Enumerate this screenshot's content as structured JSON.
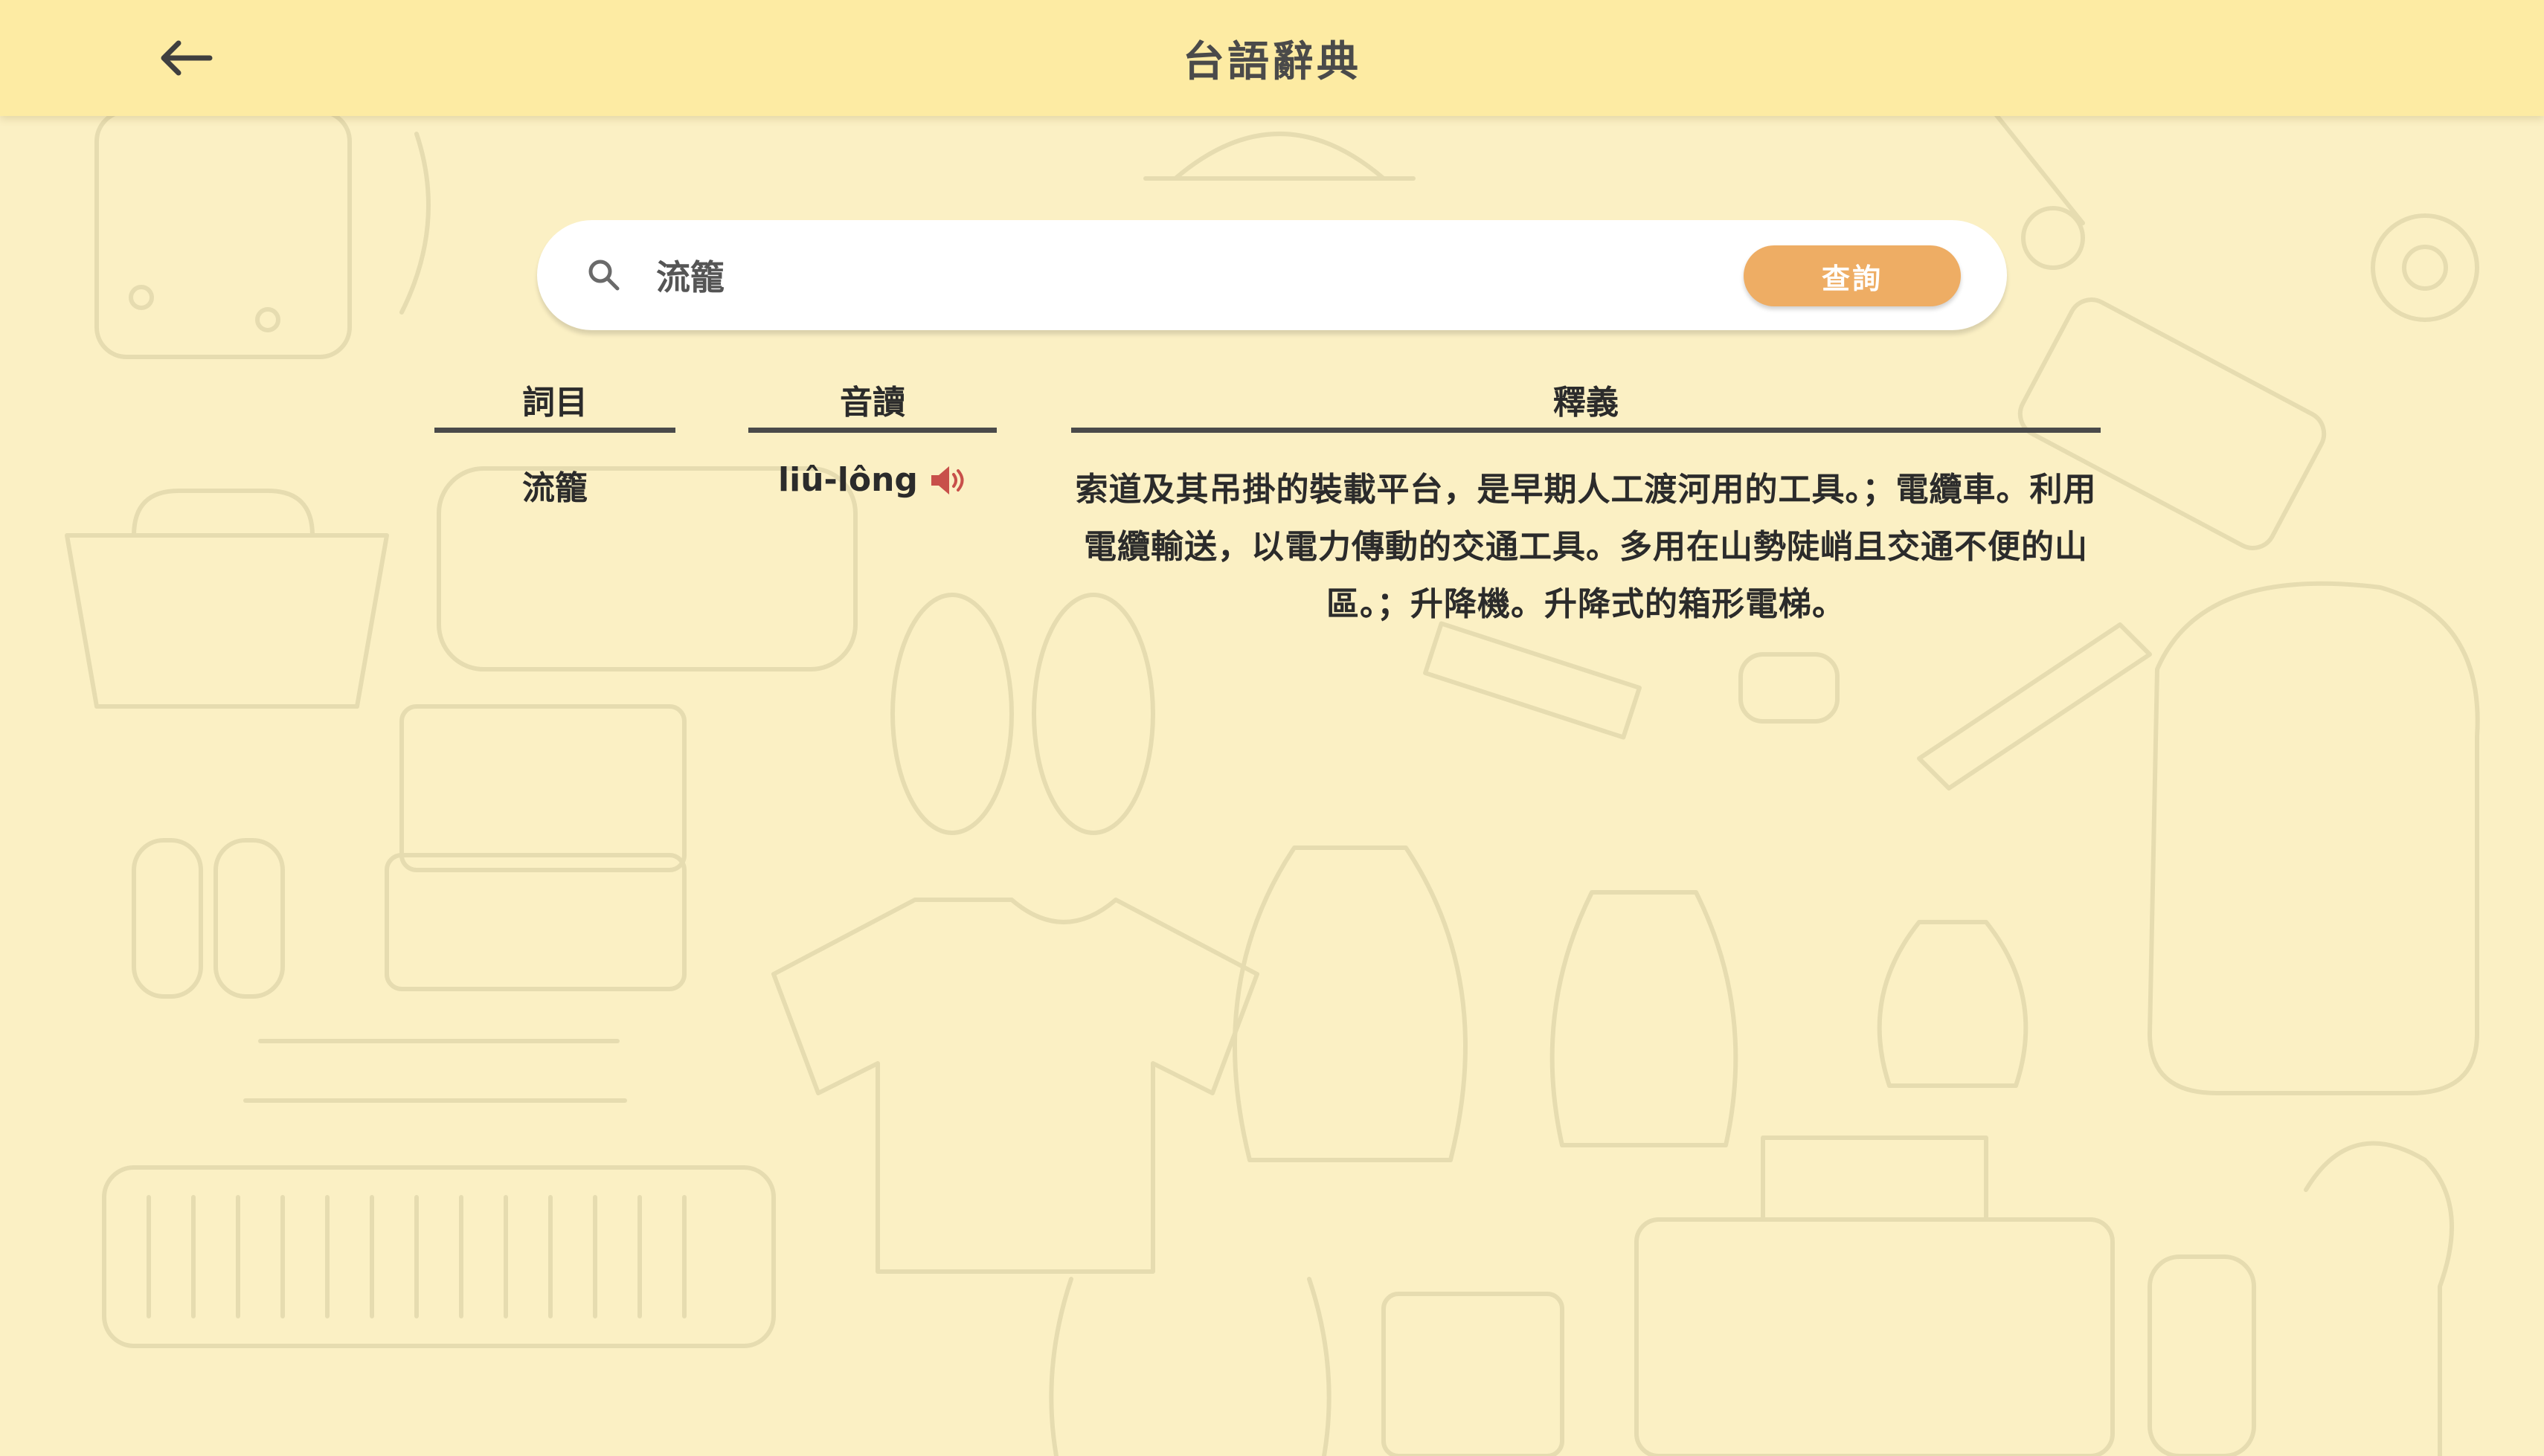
{
  "header": {
    "title": "台語辭典",
    "back_icon": "arrow-left-icon"
  },
  "search": {
    "value": "流籠",
    "icon": "search-icon",
    "button_label": "查詢"
  },
  "table": {
    "columns": [
      "詞目",
      "音讀",
      "釋義"
    ],
    "rows": [
      {
        "word": "流籠",
        "pronunciation": "liû-lông",
        "audio_icon": "speaker-icon",
        "definition": "索道及其吊掛的裝載平台，是早期人工渡河用的工具。；電纜車。利用電纜輸送，以電力傳動的交通工具。多用在山勢陡峭且交通不便的山區。；升降機。升降式的箱形電梯。"
      }
    ]
  },
  "colors": {
    "header_bg": "#fdeba3",
    "page_bg": "#fbf0c4",
    "button_bg": "#eead64",
    "speaker": "#c8504a"
  }
}
